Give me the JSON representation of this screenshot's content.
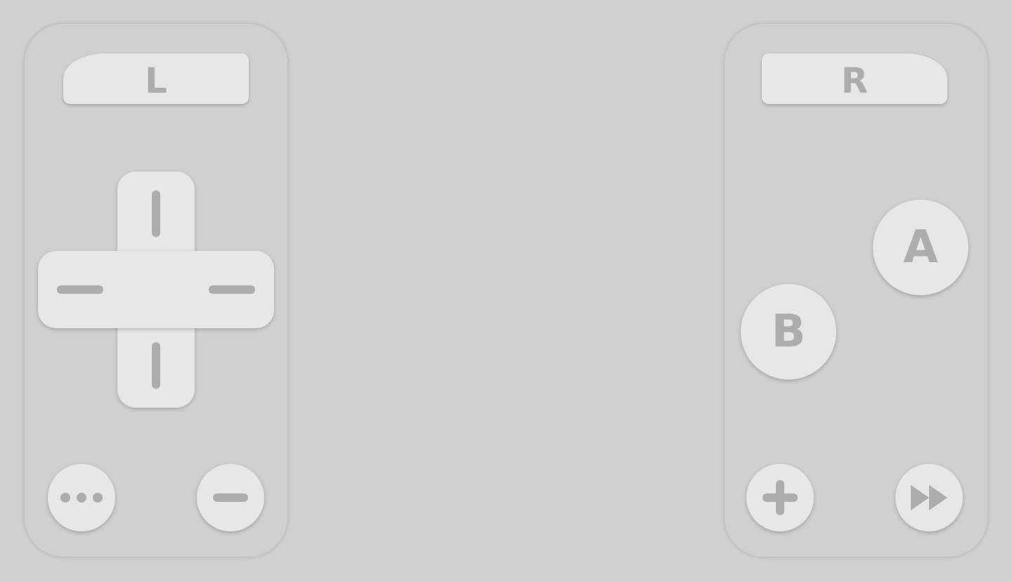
{
  "left_controller": {
    "shoulder_label": "L",
    "dpad": {
      "directions": [
        "up",
        "down",
        "left",
        "right"
      ]
    },
    "menu_button": {
      "icon": "more-icon"
    },
    "minus_button": {
      "icon": "minus-icon"
    }
  },
  "right_controller": {
    "shoulder_label": "R",
    "a_label": "A",
    "b_label": "B",
    "plus_button": {
      "icon": "plus-icon"
    },
    "fast_forward_button": {
      "icon": "fast-forward-icon"
    }
  },
  "colors": {
    "background": "#d1d1d1",
    "button_face": "#e7e7e7",
    "glyph": "#adadad"
  }
}
